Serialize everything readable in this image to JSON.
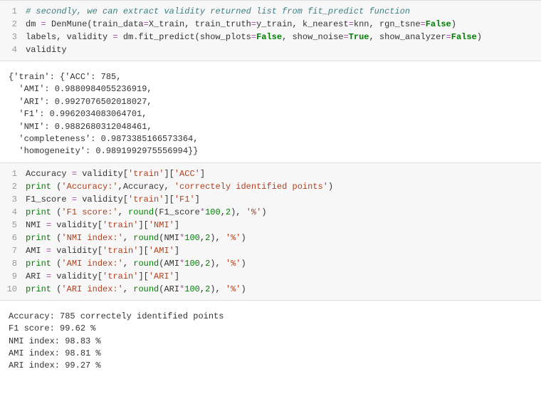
{
  "cell1": {
    "lines": [
      {
        "n": "1",
        "html": "<span class='c-comment'># secondly, we can extract validity returned list from fit_predict function</span>"
      },
      {
        "n": "2",
        "html": "dm <span class='c-op'>=</span> DenMune(train_data<span class='c-op'>=</span>X_train, train_truth<span class='c-op'>=</span>y_train, k_nearest<span class='c-op'>=</span>knn, rgn_tsne<span class='c-op'>=</span><span class='c-false'>False</span>)"
      },
      {
        "n": "3",
        "html": "labels, validity <span class='c-op'>=</span> dm.fit_predict(show_plots<span class='c-op'>=</span><span class='c-false'>False</span>, show_noise<span class='c-op'>=</span><span class='c-false'>True</span>, show_analyzer<span class='c-op'>=</span><span class='c-false'>False</span>)"
      },
      {
        "n": "4",
        "html": "validity"
      }
    ]
  },
  "output1": "{'train': {'ACC': 785,\n  'AMI': 0.9880984055236919,\n  'ARI': 0.9927076502018027,\n  'F1': 0.9962034083064701,\n  'NMI': 0.9882680312048461,\n  'completeness': 0.9873385166573364,\n  'homogeneity': 0.9891992975556994}}",
  "cell2": {
    "lines": [
      {
        "n": "1",
        "html": "Accuracy <span class='c-op'>=</span> validity[<span class='c-str'>'train'</span>][<span class='c-str'>'ACC'</span>]"
      },
      {
        "n": "2",
        "html": "<span class='c-builtin'>print</span> (<span class='c-str'>'Accuracy:'</span>,Accuracy, <span class='c-str'>'correctely identified points'</span>)"
      },
      {
        "n": "3",
        "html": "F1_score <span class='c-op'>=</span> validity[<span class='c-str'>'train'</span>][<span class='c-str'>'F1'</span>]"
      },
      {
        "n": "4",
        "html": "<span class='c-builtin'>print</span> (<span class='c-str'>'F1 score:'</span>, <span class='c-builtin'>round</span>(F1_score<span class='c-op'>*</span><span class='c-num'>100</span>,<span class='c-num'>2</span>), <span class='c-str'>'%'</span>)"
      },
      {
        "n": "5",
        "html": "NMI <span class='c-op'>=</span> validity[<span class='c-str'>'train'</span>][<span class='c-str'>'NMI'</span>]"
      },
      {
        "n": "6",
        "html": "<span class='c-builtin'>print</span> (<span class='c-str'>'NMI index:'</span>, <span class='c-builtin'>round</span>(NMI<span class='c-op'>*</span><span class='c-num'>100</span>,<span class='c-num'>2</span>), <span class='c-str'>'%'</span>)"
      },
      {
        "n": "7",
        "html": "AMI <span class='c-op'>=</span> validity[<span class='c-str'>'train'</span>][<span class='c-str'>'AMI'</span>]"
      },
      {
        "n": "8",
        "html": "<span class='c-builtin'>print</span> (<span class='c-str'>'AMI index:'</span>, <span class='c-builtin'>round</span>(AMI<span class='c-op'>*</span><span class='c-num'>100</span>,<span class='c-num'>2</span>), <span class='c-str'>'%'</span>)"
      },
      {
        "n": "9",
        "html": "ARI <span class='c-op'>=</span> validity[<span class='c-str'>'train'</span>][<span class='c-str'>'ARI'</span>]"
      },
      {
        "n": "10",
        "html": "<span class='c-builtin'>print</span> (<span class='c-str'>'ARI index:'</span>, <span class='c-builtin'>round</span>(ARI<span class='c-op'>*</span><span class='c-num'>100</span>,<span class='c-num'>2</span>), <span class='c-str'>'%'</span>)"
      }
    ]
  },
  "output2": "Accuracy: 785 correctely identified points\nF1 score: 99.62 %\nNMI index: 98.83 %\nAMI index: 98.81 %\nARI index: 99.27 %"
}
